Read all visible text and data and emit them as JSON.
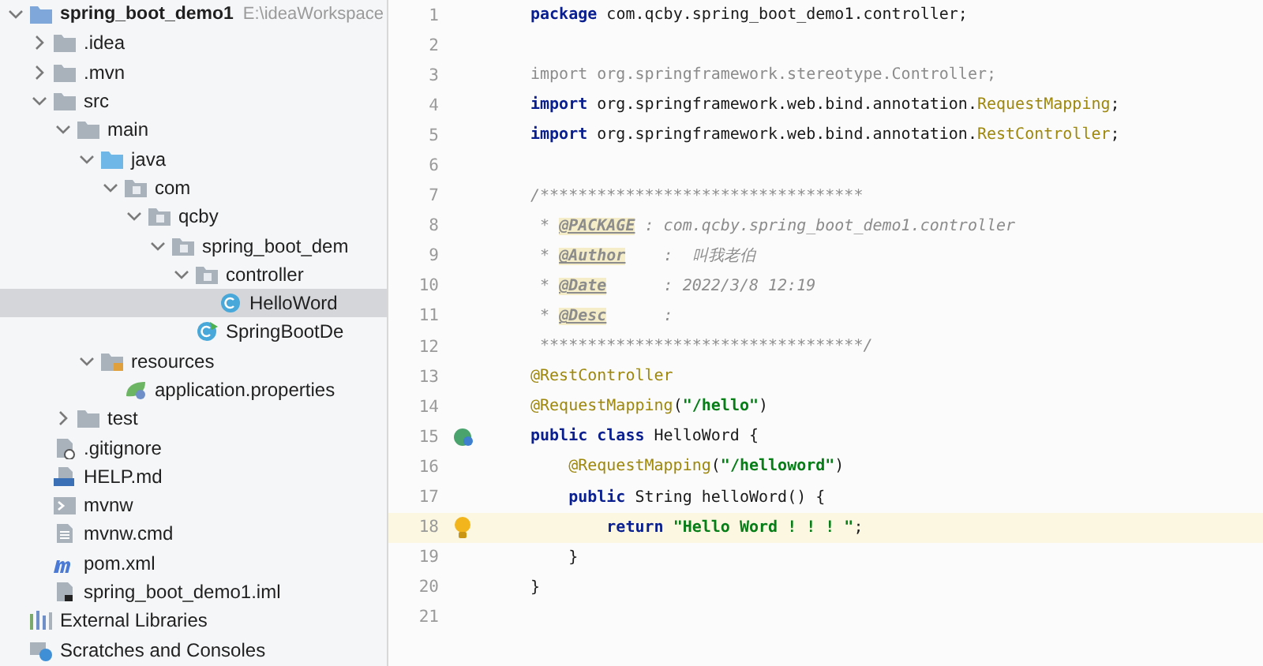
{
  "project_tree": [
    {
      "label": "spring_boot_demo1",
      "path": "E:\\ideaWorkspace",
      "kind": "module",
      "expanded": true,
      "selected": false,
      "children": [
        {
          "label": ".idea",
          "kind": "folder",
          "expanded": false,
          "selected": false
        },
        {
          "label": ".mvn",
          "kind": "folder",
          "expanded": false,
          "selected": false
        },
        {
          "label": "src",
          "kind": "folder",
          "expanded": true,
          "selected": false,
          "children": [
            {
              "label": "main",
              "kind": "folder",
              "expanded": true,
              "selected": false,
              "children": [
                {
                  "label": "java",
                  "kind": "source-folder",
                  "expanded": true,
                  "selected": false,
                  "children": [
                    {
                      "label": "com",
                      "kind": "package",
                      "expanded": true,
                      "selected": false,
                      "children": [
                        {
                          "label": "qcby",
                          "kind": "package",
                          "expanded": true,
                          "selected": false,
                          "children": [
                            {
                              "label": "spring_boot_dem",
                              "kind": "package",
                              "expanded": true,
                              "selected": false,
                              "children": [
                                {
                                  "label": "controller",
                                  "kind": "package",
                                  "expanded": true,
                                  "selected": false,
                                  "children": [
                                    {
                                      "label": "HelloWord",
                                      "kind": "class",
                                      "selected": true
                                    }
                                  ]
                                },
                                {
                                  "label": "SpringBootDe",
                                  "kind": "main-class",
                                  "selected": false
                                }
                              ]
                            }
                          ]
                        }
                      ]
                    }
                  ]
                },
                {
                  "label": "resources",
                  "kind": "resources-folder",
                  "expanded": true,
                  "selected": false,
                  "children": [
                    {
                      "label": "application.properties",
                      "kind": "properties",
                      "selected": false
                    }
                  ]
                }
              ]
            },
            {
              "label": "test",
              "kind": "folder",
              "expanded": false,
              "selected": false
            }
          ]
        },
        {
          "label": ".gitignore",
          "kind": "ignore-file",
          "selected": false
        },
        {
          "label": "HELP.md",
          "kind": "markdown",
          "selected": false
        },
        {
          "label": "mvnw",
          "kind": "script",
          "selected": false
        },
        {
          "label": "mvnw.cmd",
          "kind": "text-file",
          "selected": false
        },
        {
          "label": "pom.xml",
          "kind": "maven",
          "selected": false
        },
        {
          "label": "spring_boot_demo1.iml",
          "kind": "iml",
          "selected": false
        }
      ]
    },
    {
      "label": "External Libraries",
      "kind": "libraries",
      "selected": false
    },
    {
      "label": "Scratches and Consoles",
      "kind": "scratches",
      "selected": false
    }
  ],
  "editor": {
    "lines": [
      {
        "number": "1",
        "current": false,
        "tokens": [
          {
            "kind": "keyword",
            "text": "package"
          },
          {
            "kind": "plain",
            "text": " com.qcby.spring_boot_demo1.controller;"
          }
        ]
      },
      {
        "number": "2",
        "current": false
      },
      {
        "number": "3",
        "current": false,
        "tokens": [
          {
            "kind": "unused",
            "text": "import org.springframework.stereotype.Controller;"
          }
        ]
      },
      {
        "number": "4",
        "current": false,
        "tokens": [
          {
            "kind": "keyword",
            "text": "import"
          },
          {
            "kind": "plain",
            "text": " org.springframework.web.bind.annotation."
          },
          {
            "kind": "annotation",
            "text": "RequestMapping"
          },
          {
            "kind": "plain",
            "text": ";"
          }
        ]
      },
      {
        "number": "5",
        "current": false,
        "tokens": [
          {
            "kind": "keyword",
            "text": "import"
          },
          {
            "kind": "plain",
            "text": " org.springframework.web.bind.annotation."
          },
          {
            "kind": "annotation",
            "text": "RestController"
          },
          {
            "kind": "plain",
            "text": ";"
          }
        ]
      },
      {
        "number": "6",
        "current": false
      },
      {
        "number": "7",
        "current": false,
        "tokens": [
          {
            "kind": "comment",
            "text": "/**********************************"
          }
        ]
      },
      {
        "number": "8",
        "current": false,
        "tokens": [
          {
            "kind": "comment",
            "text": " * "
          },
          {
            "kind": "doc-tag",
            "text": "@PACKAGE"
          },
          {
            "kind": "comment",
            "text": " : com.qcby.spring_boot_demo1.controller"
          }
        ]
      },
      {
        "number": "9",
        "current": false,
        "tokens": [
          {
            "kind": "comment",
            "text": " * "
          },
          {
            "kind": "doc-tag",
            "text": "@Author"
          },
          {
            "kind": "comment",
            "text": "    :  叫我老伯"
          }
        ]
      },
      {
        "number": "10",
        "current": false,
        "tokens": [
          {
            "kind": "comment",
            "text": " * "
          },
          {
            "kind": "doc-tag",
            "text": "@Date"
          },
          {
            "kind": "comment",
            "text": "      : 2022/3/8 12:19"
          }
        ]
      },
      {
        "number": "11",
        "current": false,
        "tokens": [
          {
            "kind": "comment",
            "text": " * "
          },
          {
            "kind": "doc-tag",
            "text": "@Desc"
          },
          {
            "kind": "comment",
            "text": "      :"
          }
        ]
      },
      {
        "number": "12",
        "current": false,
        "tokens": [
          {
            "kind": "comment",
            "text": " **********************************/"
          }
        ]
      },
      {
        "number": "13",
        "current": false,
        "tokens": [
          {
            "kind": "annotation",
            "text": "@RestController"
          }
        ]
      },
      {
        "number": "14",
        "current": false,
        "tokens": [
          {
            "kind": "annotation",
            "text": "@RequestMapping"
          },
          {
            "kind": "plain",
            "text": "("
          },
          {
            "kind": "string",
            "text": "\"/hello\""
          },
          {
            "kind": "plain",
            "text": ")"
          }
        ]
      },
      {
        "number": "15",
        "current": false,
        "gutter_icon": {
          "kind": "bean"
        },
        "tokens": [
          {
            "kind": "keyword",
            "text": "public class"
          },
          {
            "kind": "plain",
            "text": " HelloWord {"
          }
        ]
      },
      {
        "number": "16",
        "current": false,
        "tokens": [
          {
            "kind": "annotation",
            "text": "    @RequestMapping"
          },
          {
            "kind": "plain",
            "text": "("
          },
          {
            "kind": "string",
            "text": "\"/helloword\""
          },
          {
            "kind": "plain",
            "text": ")"
          }
        ]
      },
      {
        "number": "17",
        "current": false,
        "tokens": [
          {
            "kind": "keyword",
            "text": "    public"
          },
          {
            "kind": "plain",
            "text": " String helloWord() {"
          }
        ]
      },
      {
        "number": "18",
        "current": true,
        "gutter_icon": {
          "kind": "bulb"
        },
        "tokens": [
          {
            "kind": "keyword",
            "text": "        return"
          },
          {
            "kind": "string",
            "text": " \"Hello Word ! ! ! \""
          },
          {
            "kind": "plain",
            "text": ";"
          }
        ]
      },
      {
        "number": "19",
        "current": false,
        "tokens": [
          {
            "kind": "plain",
            "text": "    }"
          }
        ]
      },
      {
        "number": "20",
        "current": false,
        "tokens": [
          {
            "kind": "plain",
            "text": "}"
          }
        ]
      },
      {
        "number": "21",
        "current": false
      }
    ]
  }
}
